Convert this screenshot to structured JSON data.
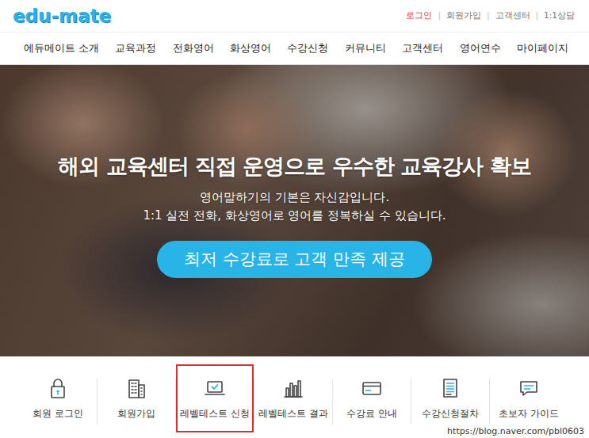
{
  "logo": {
    "text": "edu-mate"
  },
  "top_bar": {
    "separator": "|",
    "links": [
      {
        "label": "로그인",
        "color": "#e0393e"
      },
      {
        "label": "회원가입",
        "color": "#777777"
      },
      {
        "label": "고객센터",
        "color": "#777777"
      },
      {
        "label": "1:1상담",
        "color": "#777777"
      }
    ]
  },
  "nav": {
    "items": [
      "에듀메이트 소개",
      "교육과정",
      "전화영어",
      "화상영어",
      "수강신청",
      "커뮤니티",
      "고객센터",
      "영어연수",
      "마이페이지"
    ]
  },
  "hero": {
    "title": "해외 교육센터 직접 운영으로 우수한 교육강사 확보",
    "lines": [
      "영어말하기의 기본은 자신감입니다.",
      "1:1 실전 전화, 화상영어로 영어를 정복하실 수 있습니다."
    ],
    "button": "최저 수강료로 고객 만족 제공"
  },
  "quick_menu": {
    "items": [
      {
        "label": "회원 로그인",
        "kind": "login",
        "highlighted": false
      },
      {
        "label": "회원가입",
        "kind": "join",
        "highlighted": false
      },
      {
        "label": "레벨테스트 신청",
        "kind": "leveltest",
        "highlighted": true
      },
      {
        "label": "레벨테스트 결과",
        "kind": "result",
        "highlighted": false
      },
      {
        "label": "수강료 안내",
        "kind": "fee",
        "highlighted": false
      },
      {
        "label": "수강신청절차",
        "kind": "process",
        "highlighted": false
      },
      {
        "label": "초보자 가이드",
        "kind": "guide",
        "highlighted": false
      }
    ]
  },
  "watermark": "https://blog.naver.com/pbl0603"
}
